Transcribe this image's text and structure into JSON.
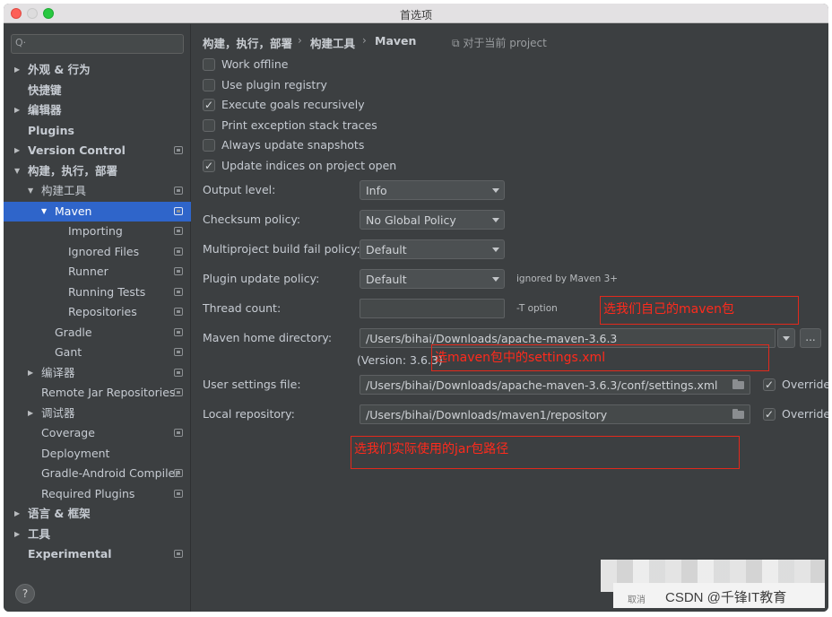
{
  "window": {
    "title": "首选项"
  },
  "sidebar": {
    "search_placeholder": "",
    "items": [
      {
        "label": "外观 & 行为",
        "arrow": "▶",
        "bold": true,
        "proj": false
      },
      {
        "label": "快捷键",
        "arrow": "",
        "bold": true,
        "proj": false
      },
      {
        "label": "编辑器",
        "arrow": "▶",
        "bold": true,
        "proj": false
      },
      {
        "label": "Plugins",
        "arrow": "",
        "bold": true,
        "proj": false
      },
      {
        "label": "Version Control",
        "arrow": "▶",
        "bold": true,
        "proj": true
      },
      {
        "label": "构建，执行，部署",
        "arrow": "▼",
        "bold": true,
        "proj": false
      },
      {
        "label": "构建工具",
        "arrow": "▼",
        "bold": false,
        "proj": true
      },
      {
        "label": "Maven",
        "arrow": "▼",
        "bold": false,
        "proj": true,
        "selected": true
      },
      {
        "label": "Importing",
        "arrow": "",
        "bold": false,
        "proj": true
      },
      {
        "label": "Ignored Files",
        "arrow": "",
        "bold": false,
        "proj": true
      },
      {
        "label": "Runner",
        "arrow": "",
        "bold": false,
        "proj": true
      },
      {
        "label": "Running Tests",
        "arrow": "",
        "bold": false,
        "proj": true
      },
      {
        "label": "Repositories",
        "arrow": "",
        "bold": false,
        "proj": true
      },
      {
        "label": "Gradle",
        "arrow": "",
        "bold": false,
        "proj": true
      },
      {
        "label": "Gant",
        "arrow": "",
        "bold": false,
        "proj": true
      },
      {
        "label": "编译器",
        "arrow": "▶",
        "bold": false,
        "proj": true
      },
      {
        "label": "Remote Jar Repositories",
        "arrow": "",
        "bold": false,
        "proj": true
      },
      {
        "label": "调试器",
        "arrow": "▶",
        "bold": false,
        "proj": false
      },
      {
        "label": "Coverage",
        "arrow": "",
        "bold": false,
        "proj": true
      },
      {
        "label": "Deployment",
        "arrow": "",
        "bold": false,
        "proj": false
      },
      {
        "label": "Gradle-Android Compiler",
        "arrow": "",
        "bold": false,
        "proj": true
      },
      {
        "label": "Required Plugins",
        "arrow": "",
        "bold": false,
        "proj": true
      },
      {
        "label": "语言 & 框架",
        "arrow": "▶",
        "bold": true,
        "proj": false
      },
      {
        "label": "工具",
        "arrow": "▶",
        "bold": true,
        "proj": false
      },
      {
        "label": "Experimental",
        "arrow": "",
        "bold": true,
        "proj": true
      }
    ],
    "help": "?"
  },
  "breadcrumb": {
    "part1": "构建，执行，部署",
    "part2": "构建工具",
    "part3": "Maven",
    "sep": "›",
    "note": "⧉ 对于当前 project"
  },
  "checkboxes": [
    {
      "label": "Work offline",
      "checked": false
    },
    {
      "label": "Use plugin registry",
      "checked": false
    },
    {
      "label": "Execute goals recursively",
      "checked": true
    },
    {
      "label": "Print exception stack traces",
      "checked": false
    },
    {
      "label": "Always update snapshots",
      "checked": false
    },
    {
      "label": "Update indices on project open",
      "checked": true
    }
  ],
  "fields": {
    "output_level": {
      "label": "Output level:",
      "value": "Info"
    },
    "checksum_policy": {
      "label": "Checksum policy:",
      "value": "No Global Policy"
    },
    "multiproject_policy": {
      "label": "Multiproject build fail policy:",
      "value": "Default"
    },
    "plugin_update_policy": {
      "label": "Plugin update policy:",
      "value": "Default",
      "note": "ignored by Maven 3+"
    },
    "thread_count": {
      "label": "Thread count:",
      "value": "",
      "note": "-T option"
    },
    "maven_home": {
      "label": "Maven home directory:",
      "value": "/Users/bihai/Downloads/apache-maven-3.6.3",
      "version": "(Version: 3.6.3)",
      "ellipsis": "..."
    },
    "user_settings": {
      "label": "User settings file:",
      "value": "/Users/bihai/Downloads/apache-maven-3.6.3/conf/settings.xml",
      "override": "Override"
    },
    "local_repo": {
      "label": "Local repository:",
      "value": "/Users/bihai/Downloads/maven1/repository",
      "override": "Override"
    }
  },
  "annotations": {
    "a1": "选我们自己的maven包",
    "a2": "选maven包中的settings.xml",
    "a3": "选我们实际使用的jar包路径"
  },
  "footer": {
    "cancel": "取消",
    "watermark": "CSDN @千锋IT教育"
  },
  "colors": {
    "selection": "#2f65ca",
    "annotation": "#e2291c",
    "background": "#3c3f41"
  }
}
